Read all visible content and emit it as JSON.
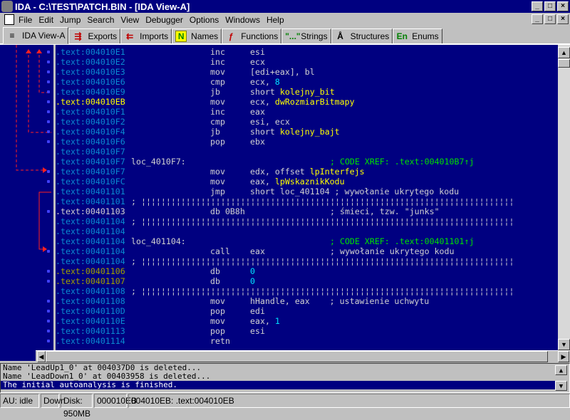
{
  "window": {
    "title": "IDA - C:\\TEST\\PATCH.BIN - [IDA View-A]",
    "controls": [
      "_",
      "□",
      "×"
    ]
  },
  "menu": [
    "File",
    "Edit",
    "Jump",
    "Search",
    "View",
    "Debugger",
    "Options",
    "Windows",
    "Help"
  ],
  "tabs": [
    {
      "label": "IDA View-A",
      "icon": "document-icon",
      "glyph": "≡",
      "active": true
    },
    {
      "label": "Exports",
      "icon": "exports-icon",
      "glyph": "⇶"
    },
    {
      "label": "Imports",
      "icon": "imports-icon",
      "glyph": "⇇"
    },
    {
      "label": "Names",
      "icon": "names-icon",
      "glyph": "N"
    },
    {
      "label": "Functions",
      "icon": "functions-icon",
      "glyph": "ƒ"
    },
    {
      "label": "Strings",
      "icon": "strings-icon",
      "glyph": "\"...\""
    },
    {
      "label": "Structures",
      "icon": "structures-icon",
      "glyph": "Å"
    },
    {
      "label": "Enums",
      "icon": "enums-icon",
      "glyph": "En"
    }
  ],
  "code": [
    {
      "addr": ".text:004010E1",
      "dot": true,
      "mn": "inc",
      "op": [
        {
          "t": "esi"
        }
      ]
    },
    {
      "addr": ".text:004010E2",
      "dot": true,
      "mn": "inc",
      "op": [
        {
          "t": "ecx"
        }
      ]
    },
    {
      "addr": ".text:004010E3",
      "dot": true,
      "mn": "mov",
      "op": [
        {
          "t": "[edi+eax], bl"
        }
      ]
    },
    {
      "addr": ".text:004010E6",
      "dot": true,
      "mn": "cmp",
      "op": [
        {
          "t": "ecx, "
        },
        {
          "t": "8",
          "c": "cy"
        }
      ]
    },
    {
      "addr": ".text:004010E9",
      "dot": true,
      "mn": "jb",
      "op": [
        {
          "t": "short "
        },
        {
          "t": "kolejny_bit",
          "c": "y"
        }
      ]
    },
    {
      "addr": ".text:004010EB",
      "style": "cur",
      "dot": true,
      "mn": "mov",
      "op": [
        {
          "t": "ecx, "
        },
        {
          "t": "dwRozmiarBitmapy",
          "c": "y"
        }
      ]
    },
    {
      "addr": ".text:004010F1",
      "dot": true,
      "mn": "inc",
      "op": [
        {
          "t": "eax"
        }
      ]
    },
    {
      "addr": ".text:004010F2",
      "dot": true,
      "mn": "cmp",
      "op": [
        {
          "t": "esi, ecx"
        }
      ]
    },
    {
      "addr": ".text:004010F4",
      "dot": true,
      "mn": "jb",
      "op": [
        {
          "t": "short "
        },
        {
          "t": "kolejny_bajt",
          "c": "y"
        }
      ]
    },
    {
      "addr": ".text:004010F6",
      "dot": true,
      "mn": "pop",
      "op": [
        {
          "t": "ebx"
        }
      ]
    },
    {
      "addr": ".text:004010F7"
    },
    {
      "addr": ".text:004010F7",
      "label": "loc_4010F7:",
      "cm": "; CODE XREF: .text:004010B7↑j"
    },
    {
      "addr": ".text:004010F7",
      "dot": true,
      "mn": "mov",
      "op": [
        {
          "t": "edx, offset "
        },
        {
          "t": "lpInterfejs",
          "c": "y"
        }
      ]
    },
    {
      "addr": ".text:004010FC",
      "dot": true,
      "mn": "mov",
      "op": [
        {
          "t": "eax, "
        },
        {
          "t": "lpWskaznikKodu",
          "c": "y"
        }
      ]
    },
    {
      "addr": ".text:00401101",
      "mn": "jmp",
      "op": [
        {
          "t": "short loc_401104 ; wywołanie ukrytego kodu"
        }
      ]
    },
    {
      "addr": ".text:00401101",
      "label": "; ¦¦¦¦¦¦¦¦¦¦¦¦¦¦¦¦¦¦¦¦¦¦¦¦¦¦¦¦¦¦¦¦¦¦¦¦¦¦¦¦¦¦¦¦¦¦¦¦¦¦¦¦¦¦¦¦¦¦¦¦¦¦¦¦¦¦¦¦¦¦¦¦¦¦¦"
    },
    {
      "addr": ".text:00401103",
      "style": "wht",
      "dot": true,
      "mn": "db 0B8h",
      "cmg": "; śmieci, tzw. \"junks\""
    },
    {
      "addr": ".text:00401104",
      "label": "; ¦¦¦¦¦¦¦¦¦¦¦¦¦¦¦¦¦¦¦¦¦¦¦¦¦¦¦¦¦¦¦¦¦¦¦¦¦¦¦¦¦¦¦¦¦¦¦¦¦¦¦¦¦¦¦¦¦¦¦¦¦¦¦¦¦¦¦¦¦¦¦¦¦¦¦"
    },
    {
      "addr": ".text:00401104"
    },
    {
      "addr": ".text:00401104",
      "label": "loc_401104:",
      "cm": "; CODE XREF: .text:00401101↑j"
    },
    {
      "addr": ".text:00401104",
      "dot": true,
      "mn": "call",
      "op": [
        {
          "t": "eax"
        }
      ],
      "cmg": "; wywołanie ukrytego kodu"
    },
    {
      "addr": ".text:00401104",
      "label": "; ¦¦¦¦¦¦¦¦¦¦¦¦¦¦¦¦¦¦¦¦¦¦¦¦¦¦¦¦¦¦¦¦¦¦¦¦¦¦¦¦¦¦¦¦¦¦¦¦¦¦¦¦¦¦¦¦¦¦¦¦¦¦¦¦¦¦¦¦¦¦¦¦¦¦¦"
    },
    {
      "addr": ".text:00401106",
      "style": "olv",
      "dot": true,
      "mn": "db",
      "op": [
        {
          "t": "0",
          "c": "cy"
        }
      ]
    },
    {
      "addr": ".text:00401107",
      "style": "olv",
      "dot": true,
      "mn": "db",
      "op": [
        {
          "t": "0",
          "c": "cy"
        }
      ]
    },
    {
      "addr": ".text:00401108",
      "label": "; ¦¦¦¦¦¦¦¦¦¦¦¦¦¦¦¦¦¦¦¦¦¦¦¦¦¦¦¦¦¦¦¦¦¦¦¦¦¦¦¦¦¦¦¦¦¦¦¦¦¦¦¦¦¦¦¦¦¦¦¦¦¦¦¦¦¦¦¦¦¦¦¦¦¦¦"
    },
    {
      "addr": ".text:00401108",
      "dot": true,
      "mn": "mov",
      "op": [
        {
          "t": "hHandle, eax    ; ustawienie uchwytu"
        }
      ]
    },
    {
      "addr": ".text:0040110D",
      "dot": true,
      "mn": "pop",
      "op": [
        {
          "t": "edi"
        }
      ]
    },
    {
      "addr": ".text:0040110E",
      "dot": true,
      "mn": "mov",
      "op": [
        {
          "t": "eax, "
        },
        {
          "t": "1",
          "c": "cy"
        }
      ]
    },
    {
      "addr": ".text:00401113",
      "dot": true,
      "mn": "pop",
      "op": [
        {
          "t": "esi"
        }
      ]
    },
    {
      "addr": ".text:00401114",
      "dot": true,
      "mn": "retn"
    }
  ],
  "messages": [
    {
      "text": "Name 'LeadUp1_0' at 004037D0 is deleted..."
    },
    {
      "text": "Name 'LeadDown1_0' at 00403958 is deleted..."
    },
    {
      "text": "The initial autoanalysis is finished.",
      "selected": true
    }
  ],
  "status": [
    "AU:  idle",
    "Down",
    "Disk: 950MB",
    "000010EB",
    "004010EB: .text:004010EB"
  ]
}
